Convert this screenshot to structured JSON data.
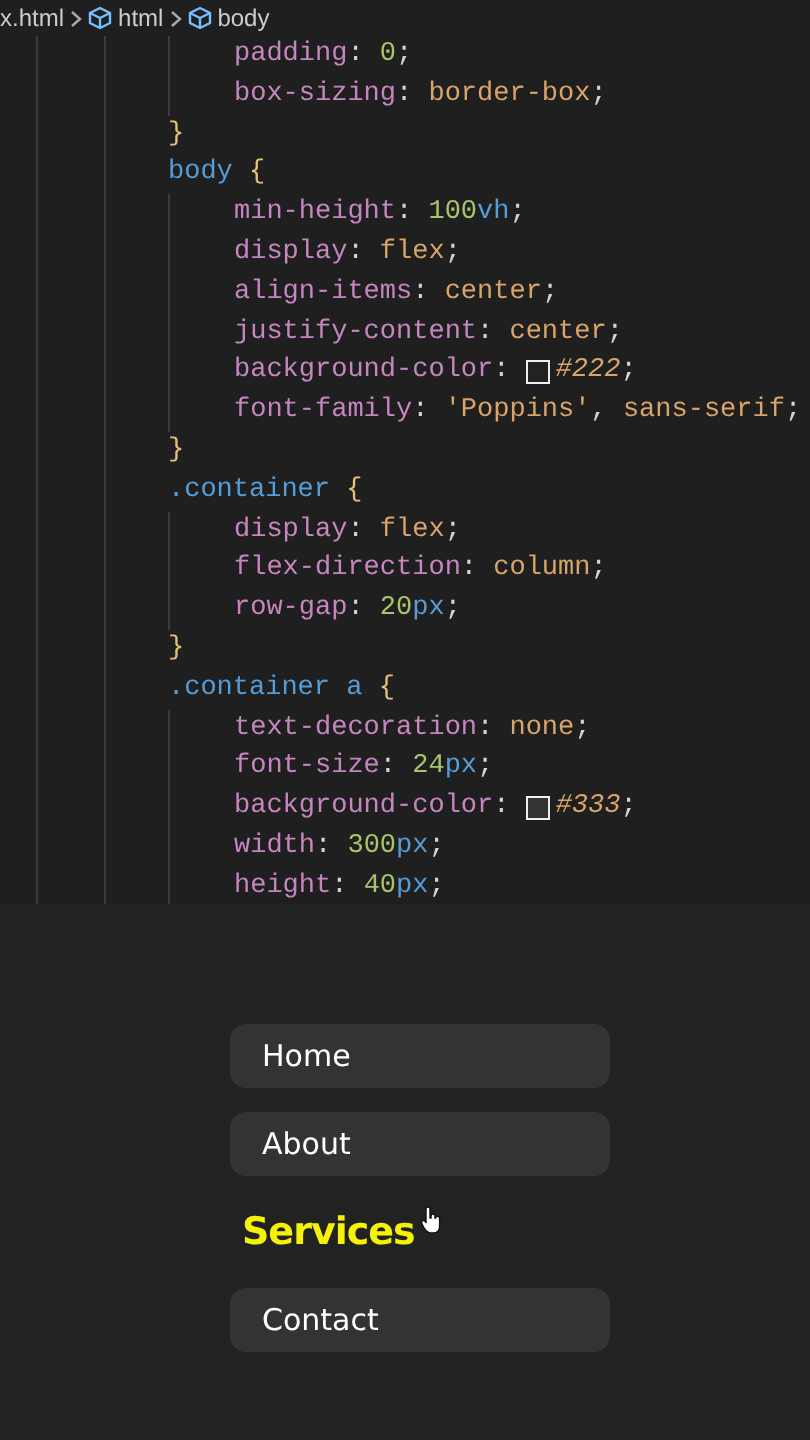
{
  "editor": {
    "breadcrumb": [
      {
        "label": "x.html",
        "kind": "file"
      },
      {
        "label": "html",
        "kind": "element"
      },
      {
        "label": "body",
        "kind": "element"
      }
    ],
    "blocks": [
      {
        "declarations": [
          [
            {
              "text": "padding",
              "kind": "property"
            },
            {
              "text": ": ",
              "kind": "punct"
            },
            {
              "text": "0",
              "kind": "number"
            },
            {
              "text": ";",
              "kind": "punct"
            }
          ],
          [
            {
              "text": "box-sizing",
              "kind": "property"
            },
            {
              "text": ": ",
              "kind": "punct"
            },
            {
              "text": "border-box",
              "kind": "keyword"
            },
            {
              "text": ";",
              "kind": "punct"
            }
          ]
        ],
        "closing": "}"
      },
      {
        "selector": [
          {
            "text": "body",
            "kind": "selector"
          },
          {
            "text": " {",
            "kind": "brace"
          }
        ],
        "declarations": [
          [
            {
              "text": "min-height",
              "kind": "property"
            },
            {
              "text": ": ",
              "kind": "punct"
            },
            {
              "text": "100",
              "kind": "number"
            },
            {
              "text": "vh",
              "kind": "unit"
            },
            {
              "text": ";",
              "kind": "punct"
            }
          ],
          [
            {
              "text": "display",
              "kind": "property"
            },
            {
              "text": ": ",
              "kind": "punct"
            },
            {
              "text": "flex",
              "kind": "keyword"
            },
            {
              "text": ";",
              "kind": "punct"
            }
          ],
          [
            {
              "text": "align-items",
              "kind": "property"
            },
            {
              "text": ": ",
              "kind": "punct"
            },
            {
              "text": "center",
              "kind": "keyword"
            },
            {
              "text": ";",
              "kind": "punct"
            }
          ],
          [
            {
              "text": "justify-content",
              "kind": "property"
            },
            {
              "text": ": ",
              "kind": "punct"
            },
            {
              "text": "center",
              "kind": "keyword"
            },
            {
              "text": ";",
              "kind": "punct"
            }
          ],
          [
            {
              "text": "background-color",
              "kind": "property"
            },
            {
              "text": ": ",
              "kind": "punct"
            },
            {
              "text": "#222",
              "kind": "color"
            },
            {
              "text": ";",
              "kind": "punct"
            }
          ],
          [
            {
              "text": "font-family",
              "kind": "property"
            },
            {
              "text": ": ",
              "kind": "punct"
            },
            {
              "text": "'Poppins'",
              "kind": "keyword"
            },
            {
              "text": ", ",
              "kind": "punct"
            },
            {
              "text": "sans-serif",
              "kind": "keyword"
            },
            {
              "text": ";",
              "kind": "punct"
            }
          ]
        ],
        "closing": "}"
      },
      {
        "selector": [
          {
            "text": ".container",
            "kind": "selector"
          },
          {
            "text": " {",
            "kind": "brace"
          }
        ],
        "declarations": [
          [
            {
              "text": "display",
              "kind": "property"
            },
            {
              "text": ": ",
              "kind": "punct"
            },
            {
              "text": "flex",
              "kind": "keyword"
            },
            {
              "text": ";",
              "kind": "punct"
            }
          ],
          [
            {
              "text": "flex-direction",
              "kind": "property"
            },
            {
              "text": ": ",
              "kind": "punct"
            },
            {
              "text": "column",
              "kind": "keyword"
            },
            {
              "text": ";",
              "kind": "punct"
            }
          ],
          [
            {
              "text": "row-gap",
              "kind": "property"
            },
            {
              "text": ": ",
              "kind": "punct"
            },
            {
              "text": "20",
              "kind": "number"
            },
            {
              "text": "px",
              "kind": "unit"
            },
            {
              "text": ";",
              "kind": "punct"
            }
          ]
        ],
        "closing": "}"
      },
      {
        "selector": [
          {
            "text": ".container a",
            "kind": "selector"
          },
          {
            "text": " {",
            "kind": "brace"
          }
        ],
        "declarations": [
          [
            {
              "text": "text-decoration",
              "kind": "property"
            },
            {
              "text": ": ",
              "kind": "punct"
            },
            {
              "text": "none",
              "kind": "keyword"
            },
            {
              "text": ";",
              "kind": "punct"
            }
          ],
          [
            {
              "text": "font-size",
              "kind": "property"
            },
            {
              "text": ": ",
              "kind": "punct"
            },
            {
              "text": "24",
              "kind": "number"
            },
            {
              "text": "px",
              "kind": "unit"
            },
            {
              "text": ";",
              "kind": "punct"
            }
          ],
          [
            {
              "text": "background-color",
              "kind": "property"
            },
            {
              "text": ": ",
              "kind": "punct"
            },
            {
              "text": "#333",
              "kind": "color"
            },
            {
              "text": ";",
              "kind": "punct"
            }
          ],
          [
            {
              "text": "width",
              "kind": "property"
            },
            {
              "text": ": ",
              "kind": "punct"
            },
            {
              "text": "300",
              "kind": "number"
            },
            {
              "text": "px",
              "kind": "unit"
            },
            {
              "text": ";",
              "kind": "punct"
            }
          ],
          [
            {
              "text": "height",
              "kind": "property"
            },
            {
              "text": ": ",
              "kind": "punct"
            },
            {
              "text": "40",
              "kind": "number"
            },
            {
              "text": "px",
              "kind": "unit"
            },
            {
              "text": ";",
              "kind": "punct"
            }
          ]
        ]
      }
    ]
  },
  "preview": {
    "links": [
      {
        "label": "Home",
        "hovered": false
      },
      {
        "label": "About",
        "hovered": false
      },
      {
        "label": "Services",
        "hovered": true
      },
      {
        "label": "Contact",
        "hovered": false
      }
    ]
  }
}
